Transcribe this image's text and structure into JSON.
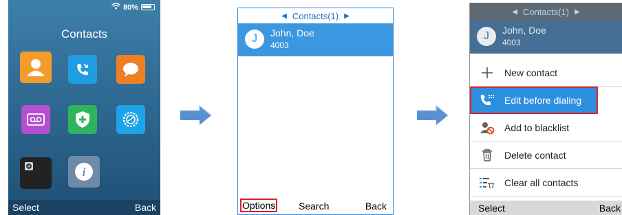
{
  "screen1": {
    "status": {
      "battery": "80%"
    },
    "title": "Contacts",
    "softkeys": {
      "left": "Select",
      "right": "Back"
    },
    "apps": [
      {
        "icon": "contacts-icon",
        "color": "#f39c2c"
      },
      {
        "icon": "call-history-icon",
        "color": "#1e9ee0"
      },
      {
        "icon": "messages-icon",
        "color": "#f07f24"
      },
      {
        "icon": "voicemail-icon",
        "color": "#b44fd0"
      },
      {
        "icon": "shield-plus-icon",
        "color": "#2cb55a"
      },
      {
        "icon": "settings-icon",
        "color": "#1da3e8"
      },
      {
        "icon": "camera-app-icon",
        "color": "#222222"
      },
      {
        "icon": "info-icon",
        "color": "#6e8aa8"
      }
    ]
  },
  "screen2": {
    "header": "Contacts(1)",
    "contact": {
      "initial": "J",
      "name": "John, Doe",
      "number": "4003"
    },
    "softkeys": {
      "left": "Options",
      "center": "Search",
      "right": "Back"
    }
  },
  "screen3": {
    "header": "Contacts(1)",
    "contact": {
      "initial": "J",
      "name": "John, Doe",
      "number": "4003"
    },
    "menu": [
      {
        "label": "New contact",
        "icon": "plus-icon"
      },
      {
        "label": "Edit before dialing",
        "icon": "edit-dial-icon"
      },
      {
        "label": "Add to blacklist",
        "icon": "blacklist-icon"
      },
      {
        "label": "Delete contact",
        "icon": "trash-icon"
      },
      {
        "label": "Clear all contacts",
        "icon": "clear-list-icon"
      }
    ],
    "softkeys": {
      "left": "Select",
      "right": "Back"
    }
  },
  "colors": {
    "accent": "#3a97e0",
    "highlight": "#e0202a",
    "arrow": "#5b8fd3"
  }
}
